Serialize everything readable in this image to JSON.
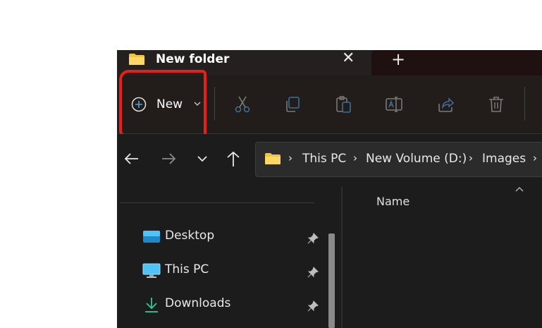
{
  "tab": {
    "title": "New folder"
  },
  "commandbar": {
    "new_label": "New"
  },
  "breadcrumb": {
    "items": [
      "This PC",
      "New Volume (D:)",
      "Images"
    ]
  },
  "sidebar": {
    "items": [
      {
        "label": "Desktop"
      },
      {
        "label": "This PC"
      },
      {
        "label": "Downloads"
      }
    ]
  },
  "files": {
    "columns": {
      "name": "Name"
    }
  },
  "colors": {
    "accent": "#4aa3e0",
    "highlight": "#e8201a",
    "folder": "#f4c242"
  }
}
